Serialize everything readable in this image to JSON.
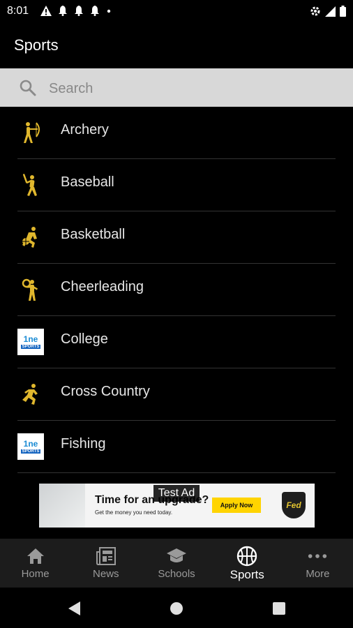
{
  "status_bar": {
    "time": "8:01",
    "left_icons": [
      "warning-icon",
      "bell-icon",
      "bell-icon",
      "bell-icon",
      "dot-icon"
    ],
    "right_icons": [
      "settings-icon",
      "signal-icon",
      "battery-icon"
    ]
  },
  "header": {
    "title": "Sports"
  },
  "search": {
    "placeholder": "Search",
    "value": ""
  },
  "sports": [
    {
      "label": "Archery",
      "icon": "archery-icon"
    },
    {
      "label": "Baseball",
      "icon": "baseball-icon"
    },
    {
      "label": "Basketball",
      "icon": "basketball-icon"
    },
    {
      "label": "Cheerleading",
      "icon": "cheerleading-icon"
    },
    {
      "label": "College",
      "icon": "one-sports-logo"
    },
    {
      "label": "Cross Country",
      "icon": "cross-country-icon"
    },
    {
      "label": "Fishing",
      "icon": "one-sports-logo"
    }
  ],
  "logo_text": {
    "one": "1ne",
    "sports": "SPORTS"
  },
  "ad": {
    "badge": "Test Ad",
    "headline": "Time for an upgrade?",
    "subtext": "Get the money you need today.",
    "button": "Apply Now",
    "logo_text": "Fed"
  },
  "bottom_nav": [
    {
      "label": "Home",
      "icon": "home-icon",
      "active": false
    },
    {
      "label": "News",
      "icon": "news-icon",
      "active": false
    },
    {
      "label": "Schools",
      "icon": "schools-icon",
      "active": false
    },
    {
      "label": "Sports",
      "icon": "basketball-icon",
      "active": true
    },
    {
      "label": "More",
      "icon": "more-icon",
      "active": false
    }
  ],
  "colors": {
    "accent": "#e0b72d",
    "search_bg": "#d8d8d8",
    "nav_bg": "#1c1c1c"
  }
}
